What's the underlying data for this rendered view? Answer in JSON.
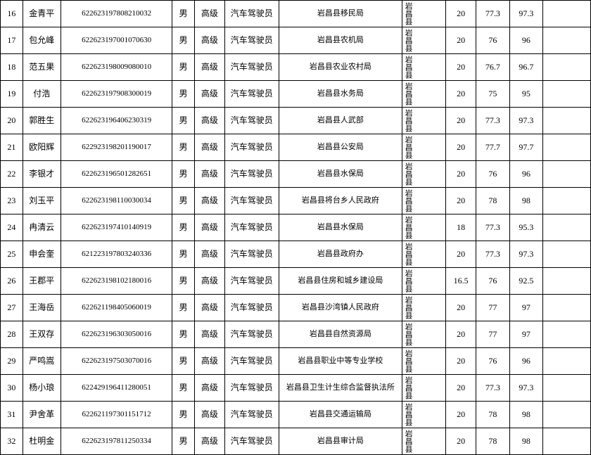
{
  "table": {
    "rows": [
      {
        "num": "16",
        "name": "金青平",
        "id": "622623197808210032",
        "gender": "男",
        "level": "高级",
        "type": "汽车驾驶员",
        "unit": "岩昌县移民局",
        "cert": "岩昌县",
        "score1": "20",
        "score2": "77.3",
        "score3": "97.3",
        "remark": ""
      },
      {
        "num": "17",
        "name": "包允峰",
        "id": "622623197001070630",
        "gender": "男",
        "level": "高级",
        "type": "汽车驾驶员",
        "unit": "岩昌县农机局",
        "cert": "岩昌县",
        "score1": "20",
        "score2": "76",
        "score3": "96",
        "remark": ""
      },
      {
        "num": "18",
        "name": "范五果",
        "id": "622623198009080010",
        "gender": "男",
        "level": "高级",
        "type": "汽车驾驶员",
        "unit": "岩昌县农业农村局",
        "cert": "岩昌县",
        "score1": "20",
        "score2": "76.7",
        "score3": "96.7",
        "remark": ""
      },
      {
        "num": "19",
        "name": "付浩",
        "id": "622623197908300019",
        "gender": "男",
        "level": "高级",
        "type": "汽车驾驶员",
        "unit": "岩昌县水务局",
        "cert": "岩昌县",
        "score1": "20",
        "score2": "75",
        "score3": "95",
        "remark": ""
      },
      {
        "num": "20",
        "name": "郭胜生",
        "id": "622623196406230319",
        "gender": "男",
        "level": "高级",
        "type": "汽车驾驶员",
        "unit": "岩昌县人武部",
        "cert": "岩昌县",
        "score1": "20",
        "score2": "77.3",
        "score3": "97.3",
        "remark": ""
      },
      {
        "num": "21",
        "name": "欧阳辉",
        "id": "622923198201190017",
        "gender": "男",
        "level": "高级",
        "type": "汽车驾驶员",
        "unit": "岩昌县公安局",
        "cert": "岩昌县",
        "score1": "20",
        "score2": "77.7",
        "score3": "97.7",
        "remark": ""
      },
      {
        "num": "22",
        "name": "李银才",
        "id": "622623196501282651",
        "gender": "男",
        "level": "高级",
        "type": "汽车驾驶员",
        "unit": "岩昌县水保局",
        "cert": "岩昌县",
        "score1": "20",
        "score2": "76",
        "score3": "96",
        "remark": ""
      },
      {
        "num": "23",
        "name": "刘玉平",
        "id": "622623198110030034",
        "gender": "男",
        "level": "高级",
        "type": "汽车驾驶员",
        "unit": "岩昌县将台乡人民政府",
        "cert": "岩昌县",
        "score1": "20",
        "score2": "78",
        "score3": "98",
        "remark": ""
      },
      {
        "num": "24",
        "name": "冉清云",
        "id": "622623197410140919",
        "gender": "男",
        "level": "高级",
        "type": "汽车驾驶员",
        "unit": "岩昌县水保局",
        "cert": "岩昌县",
        "score1": "18",
        "score2": "77.3",
        "score3": "95.3",
        "remark": ""
      },
      {
        "num": "25",
        "name": "申会奎",
        "id": "621223197803240336",
        "gender": "男",
        "level": "高级",
        "type": "汽车驾驶员",
        "unit": "岩昌县政府办",
        "cert": "岩昌县",
        "score1": "20",
        "score2": "77.3",
        "score3": "97.3",
        "remark": ""
      },
      {
        "num": "26",
        "name": "王郡平",
        "id": "622623198102180016",
        "gender": "男",
        "level": "高级",
        "type": "汽车驾驶员",
        "unit": "岩昌县住房和城乡建设局",
        "cert": "岩昌县",
        "score1": "16.5",
        "score2": "76",
        "score3": "92.5",
        "remark": ""
      },
      {
        "num": "27",
        "name": "王海岳",
        "id": "622621198405060019",
        "gender": "男",
        "level": "高级",
        "type": "汽车驾驶员",
        "unit": "岩昌县沙湾镇人民政府",
        "cert": "岩昌县",
        "score1": "20",
        "score2": "77",
        "score3": "97",
        "remark": ""
      },
      {
        "num": "28",
        "name": "王双存",
        "id": "622623196303050016",
        "gender": "男",
        "level": "高级",
        "type": "汽车驾驶员",
        "unit": "岩昌县自然资源局",
        "cert": "岩昌县",
        "score1": "20",
        "score2": "77",
        "score3": "97",
        "remark": ""
      },
      {
        "num": "29",
        "name": "严鸣嵩",
        "id": "622623197503070016",
        "gender": "男",
        "level": "高级",
        "type": "汽车驾驶员",
        "unit": "岩昌县职业中等专业学校",
        "cert": "岩昌县",
        "score1": "20",
        "score2": "76",
        "score3": "96",
        "remark": ""
      },
      {
        "num": "30",
        "name": "杨小琅",
        "id": "622429196411280051",
        "gender": "男",
        "level": "高级",
        "type": "汽车驾驶员",
        "unit": "岩昌县卫生计生综合监督执法所",
        "cert": "岩昌县",
        "score1": "20",
        "score2": "77.3",
        "score3": "97.3",
        "remark": ""
      },
      {
        "num": "31",
        "name": "尹舍革",
        "id": "622621197301151712",
        "gender": "男",
        "level": "高级",
        "type": "汽车驾驶员",
        "unit": "岩昌县交通运输局",
        "cert": "岩昌县",
        "score1": "20",
        "score2": "78",
        "score3": "98",
        "remark": ""
      },
      {
        "num": "32",
        "name": "杜明金",
        "id": "622623197811250334",
        "gender": "男",
        "level": "高级",
        "type": "汽车驾驶员",
        "unit": "岩昌县审计局",
        "cert": "岩昌县",
        "score1": "20",
        "score2": "78",
        "score3": "98",
        "remark": ""
      }
    ]
  }
}
